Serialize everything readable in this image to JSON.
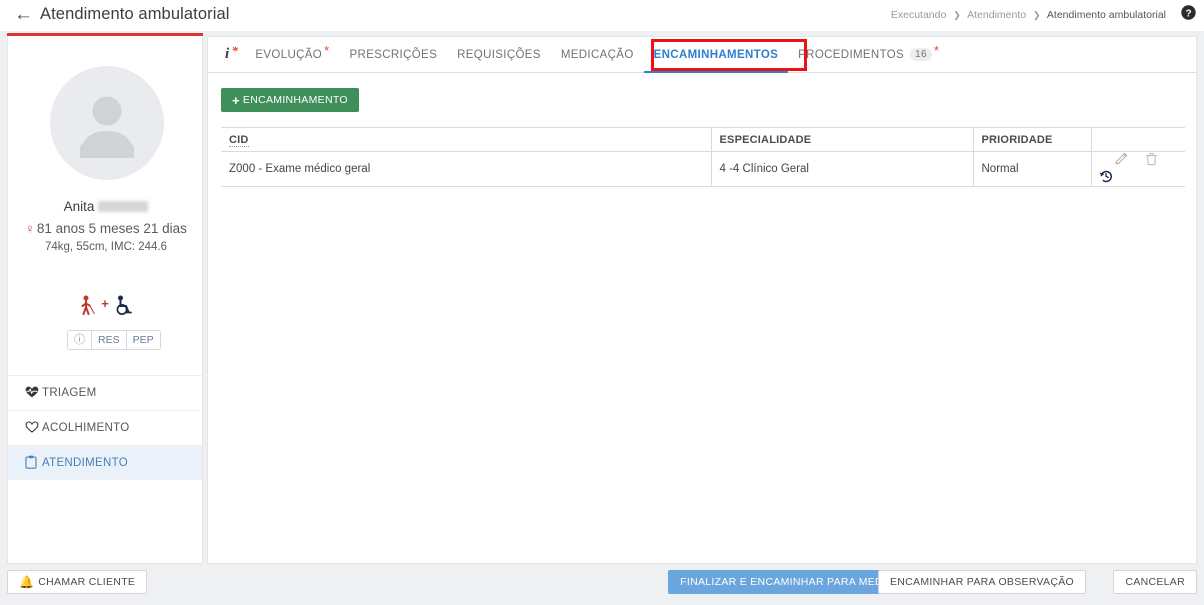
{
  "header": {
    "back_icon": "arrow-left-icon",
    "title": "Atendimento ambulatorial",
    "breadcrumb": [
      "Executando",
      "Atendimento",
      "Atendimento ambulatorial"
    ],
    "help_icon": "help-circle-icon"
  },
  "sidebar": {
    "accent_color": "#dd3333",
    "avatar_icon": "person-placeholder-icon",
    "patient": {
      "first_name": "Anita",
      "surname_redacted": true,
      "gender_icon": "female-icon",
      "age": "81 anos 5 meses 21 dias",
      "metrics": "74kg, 55cm, IMC: 244.6",
      "flags": [
        "blind-person-icon",
        "plus-icon",
        "wheelchair-icon"
      ]
    },
    "pills": [
      {
        "label": "",
        "icon": "info-circle-icon"
      },
      {
        "label": "RES",
        "icon": ""
      },
      {
        "label": "PEP",
        "icon": ""
      }
    ],
    "nav": [
      {
        "label": "TRIAGEM",
        "icon": "heart-pulse-filled-icon",
        "active": false
      },
      {
        "label": "ACOLHIMENTO",
        "icon": "heart-outline-icon",
        "active": false
      },
      {
        "label": "ATENDIMENTO",
        "icon": "clipboard-icon",
        "active": true
      }
    ]
  },
  "main": {
    "tabs": [
      {
        "label": "i",
        "type": "info",
        "star": true,
        "selected": false
      },
      {
        "label": "EVOLUÇÃO",
        "star": true,
        "selected": false
      },
      {
        "label": "PRESCRIÇÕES",
        "star": false,
        "selected": false
      },
      {
        "label": "REQUISIÇÕES",
        "star": false,
        "selected": false
      },
      {
        "label": "MEDICAÇÃO",
        "star": false,
        "selected": false
      },
      {
        "label": "ENCAMINHAMENTOS",
        "star": false,
        "selected": true
      },
      {
        "label": "PROCEDIMENTOS",
        "star": true,
        "selected": false,
        "count": "16"
      }
    ],
    "highlight_color": "#ee1111",
    "accent_color": "#2f7fd1",
    "add_button": {
      "label": "ENCAMINHAMENTO",
      "icon": "plus-icon",
      "color": "#3f8f5b"
    },
    "table": {
      "columns": [
        "CID",
        "ESPECIALIDADE",
        "PRIORIDADE",
        ""
      ],
      "rows": [
        {
          "cid": "Z000 - Exame médico geral",
          "especialidade": "4 -4 Clínico Geral",
          "prioridade": "Normal",
          "actions": [
            "edit-pencil-icon",
            "trash-icon",
            "history-restore-icon"
          ]
        }
      ]
    }
  },
  "footer": {
    "chamar_cliente": {
      "label": "CHAMAR CLIENTE",
      "icon": "bell-icon"
    },
    "finalizar": {
      "label": "FINALIZAR E ENCAMINHAR PARA MEDICAÇÃO",
      "color": "#6aa6dd"
    },
    "observacao": {
      "label": "ENCAMINHAR PARA OBSERVAÇÃO"
    },
    "cancelar": {
      "label": "CANCELAR"
    }
  }
}
